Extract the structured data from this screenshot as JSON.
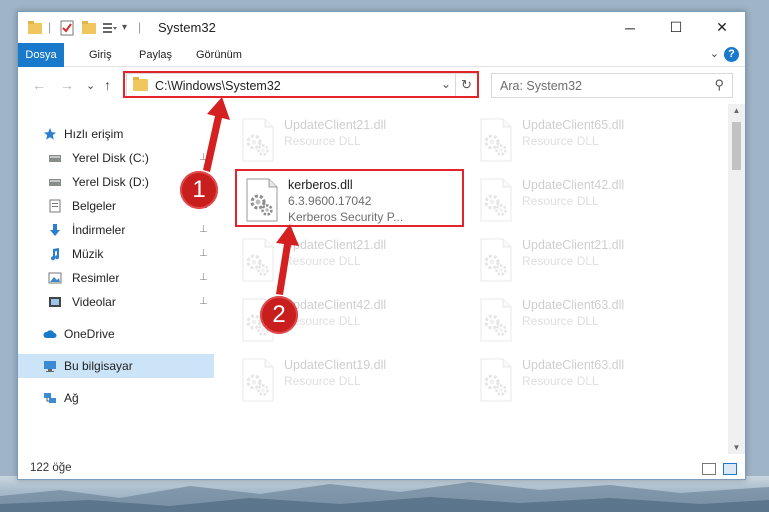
{
  "window": {
    "title": "System32",
    "minimize_glyph": "─",
    "maximize_glyph": "☐",
    "close_glyph": "✕"
  },
  "ribbon": {
    "tabs": [
      "Dosya",
      "Giriş",
      "Paylaş",
      "Görünüm"
    ],
    "expand_glyph": "⌄",
    "help_glyph": "?"
  },
  "nav": {
    "back_glyph": "←",
    "forward_glyph": "→",
    "recent_glyph": "⌄",
    "up_glyph": "↑",
    "address_path": "C:\\Windows\\System32",
    "address_dropdown_glyph": "⌄",
    "refresh_glyph": "↻",
    "search_placeholder": "Ara: System32",
    "search_glyph": "⚲"
  },
  "sidebar": {
    "items": [
      {
        "label": "Hızlı erişim",
        "icon": "star-icon",
        "pinned": false,
        "indent": 1
      },
      {
        "label": "Yerel Disk (C:)",
        "icon": "drive-icon",
        "pinned": true,
        "indent": 2
      },
      {
        "label": "Yerel Disk (D:)",
        "icon": "drive-icon",
        "pinned": true,
        "indent": 2
      },
      {
        "label": "Belgeler",
        "icon": "documents-icon",
        "pinned": true,
        "indent": 2
      },
      {
        "label": "İndirmeler",
        "icon": "download-icon",
        "pinned": true,
        "indent": 2
      },
      {
        "label": "Müzik",
        "icon": "music-icon",
        "pinned": true,
        "indent": 2
      },
      {
        "label": "Resimler",
        "icon": "pictures-icon",
        "pinned": true,
        "indent": 2
      },
      {
        "label": "Videolar",
        "icon": "videos-icon",
        "pinned": true,
        "indent": 2
      },
      {
        "label": "OneDrive",
        "icon": "cloud-icon",
        "pinned": false,
        "indent": 1
      },
      {
        "label": "Bu bilgisayar",
        "icon": "computer-icon",
        "pinned": false,
        "indent": 1,
        "selected": true
      },
      {
        "label": "Ağ",
        "icon": "network-icon",
        "pinned": false,
        "indent": 1
      }
    ],
    "pin_glyph": "📌"
  },
  "files": {
    "highlighted": {
      "name": "kerberos.dll",
      "version": "6.3.9600.17042",
      "description": "Kerberos Security P..."
    },
    "faded": [
      {
        "name": "UpdateClient21.dll",
        "type": "Resource DLL"
      },
      {
        "name": "UpdateClient65.dll",
        "type": "Resource DLL"
      },
      {
        "name": "UpdateClient42.dll",
        "type": "Resource DLL"
      },
      {
        "name": "UpdateClient21.dll",
        "type": "Resource DLL"
      },
      {
        "name": "UpdateClient21.dll",
        "type": "Resource DLL"
      },
      {
        "name": "UpdateClient42.dll",
        "type": "Resource DLL"
      },
      {
        "name": "UpdateClient63.dll",
        "type": "Resource DLL"
      },
      {
        "name": "UpdateClient19.dll",
        "type": "Resource DLL"
      },
      {
        "name": "UpdateClient63.dll",
        "type": "Resource DLL"
      }
    ]
  },
  "status": {
    "item_count": "122 öğe"
  },
  "annotations": {
    "step1": "1",
    "step2": "2",
    "color": "#e3242b"
  },
  "colors": {
    "accent": "#1979ca",
    "selection": "#cce4f7"
  }
}
